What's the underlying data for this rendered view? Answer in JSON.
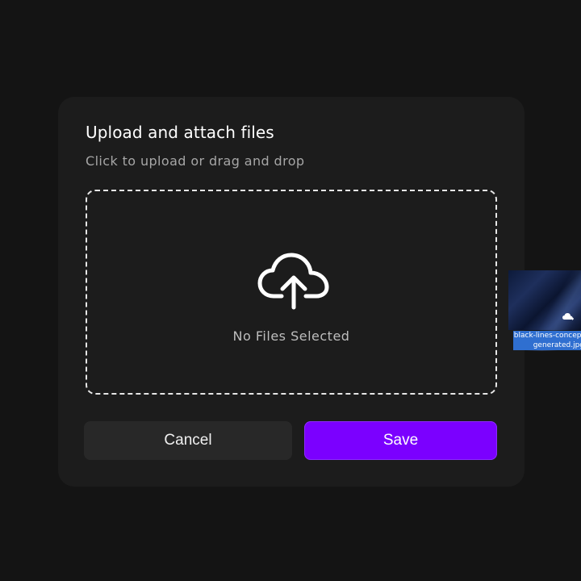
{
  "modal": {
    "title": "Upload and attach files",
    "subtitle": "Click to upload or drag and drop",
    "dropzone": {
      "icon": "cloud-upload-icon",
      "status": "No Files Selected"
    },
    "buttons": {
      "cancel_label": "Cancel",
      "save_label": "Save"
    }
  },
  "dragged_file": {
    "name_line1": "black-lines-concept",
    "name_line2": "generated.jpg",
    "cursor_icon": "drag-copy-cursor-icon"
  },
  "colors": {
    "background": "#141414",
    "modal": "#1c1c1c",
    "accent": "#7b00ff",
    "cancel_button": "#282828",
    "file_label": "#2f6fd0"
  }
}
